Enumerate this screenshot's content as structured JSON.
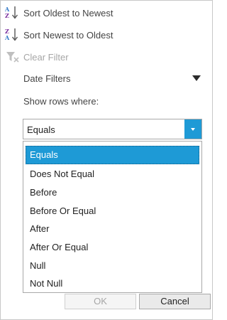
{
  "menu": {
    "sort_asc": {
      "label": "Sort Oldest to Newest",
      "icon": "sort-ascending-icon"
    },
    "sort_desc": {
      "label": "Sort Newest to Oldest",
      "icon": "sort-descending-icon"
    },
    "clear_filter": {
      "label": "Clear Filter",
      "icon": "clear-filter-icon",
      "disabled": true
    }
  },
  "date_filters": {
    "label": "Date Filters",
    "icon": "triangle-down-icon"
  },
  "show_rows_label": "Show rows where:",
  "condition": {
    "selected": "Equals",
    "options": [
      "Equals",
      "Does Not Equal",
      "Before",
      "Before Or Equal",
      "After",
      "After Or Equal",
      "Null",
      "Not Null"
    ]
  },
  "buttons": {
    "ok": "OK",
    "cancel": "Cancel"
  },
  "colors": {
    "accent": "#1e9ad6",
    "disabled_text": "#a6a6a6",
    "border": "#a9a9a9"
  }
}
